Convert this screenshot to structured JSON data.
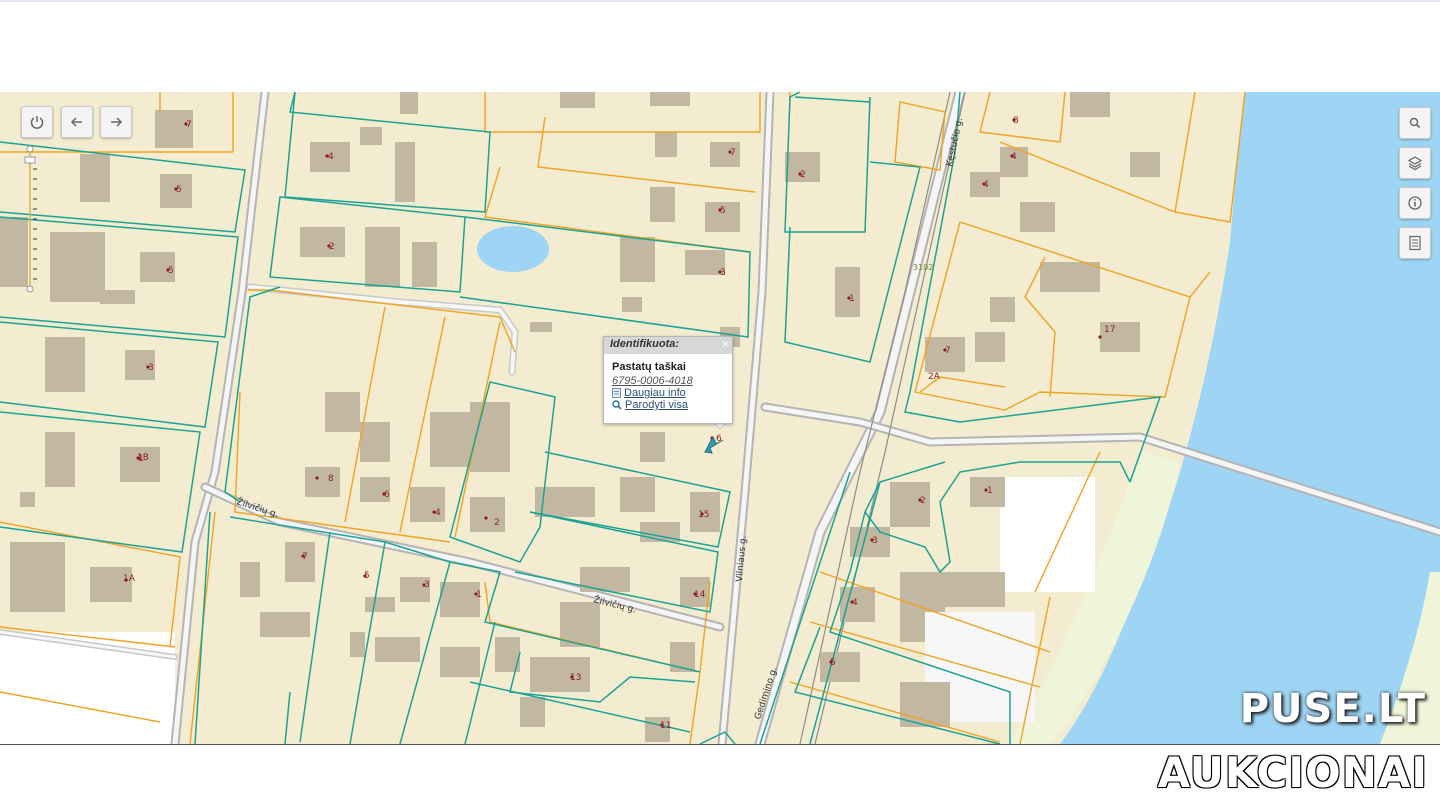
{
  "map": {
    "street_labels": [
      "Žilvičių g.",
      "Žilvičių g.",
      "Vilniaus g.",
      "Gedimino g.",
      "Kęstučio g."
    ],
    "road_number": "3102",
    "house_numbers": [
      "7",
      "4",
      "7",
      "5",
      "5",
      "2",
      "5",
      "3",
      "3",
      "1",
      "1B",
      "1A",
      "8",
      "6",
      "4",
      "2",
      "15",
      "14",
      "7",
      "5",
      "3",
      "1",
      "13",
      "11",
      "6",
      "2",
      "1",
      "8",
      "4",
      "4",
      "17",
      "7",
      "2A",
      "2",
      "1",
      "3",
      "4",
      "5"
    ],
    "colors": {
      "land": "#f3ecd0",
      "water": "#9ed4f4",
      "shore": "#eef5d9",
      "parcel_teal": "#1aa394",
      "parcel_orange": "#f0a321",
      "building": "#c2b8a2",
      "road": "#a9a9a9"
    }
  },
  "controls": {
    "left": [
      "power-icon",
      "back-arrow-icon",
      "forward-arrow-icon"
    ],
    "right": [
      "search-icon",
      "layers-icon",
      "info-icon",
      "document-icon"
    ]
  },
  "popup": {
    "header": "Identifikuota:",
    "close": "×",
    "title": "Pastatų taškai",
    "id": "6795-0006-4018",
    "link_more": "Daugiau info",
    "link_show": "Parodyti visa"
  },
  "watermark": {
    "line1": "PUSE.LT",
    "line2": "AUKCIONAI"
  }
}
